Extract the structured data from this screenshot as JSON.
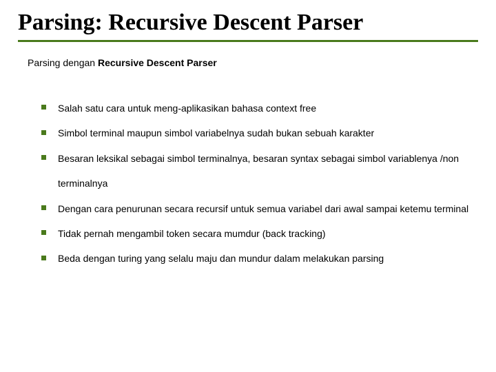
{
  "title": "Parsing: Recursive Descent Parser",
  "subtitle_prefix": "Parsing dengan ",
  "subtitle_bold": "Recursive Descent Parser",
  "bullets": {
    "0": "Salah satu cara untuk meng-aplikasikan bahasa context free",
    "1": "Simbol terminal maupun simbol variabelnya sudah bukan sebuah karakter",
    "2": "Besaran leksikal sebagai simbol terminalnya, besaran syntax sebagai simbol variablenya /non terminalnya",
    "3": "Dengan cara penurunan secara recursif untuk semua variabel dari awal sampai ketemu terminal",
    "4": "Tidak pernah mengambil token secara mumdur (back tracking)",
    "5": "Beda dengan turing yang selalu maju dan mundur dalam melakukan parsing"
  },
  "colors": {
    "accent": "#4a7a1c"
  }
}
